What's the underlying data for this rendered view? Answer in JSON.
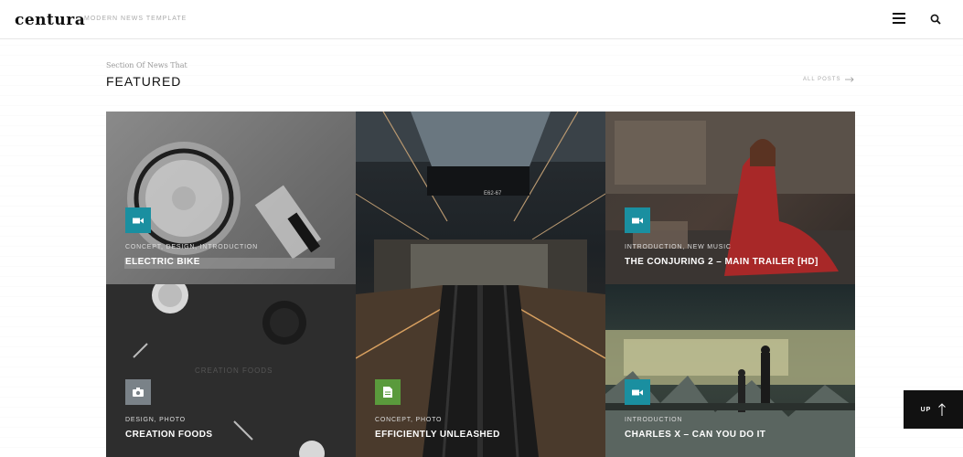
{
  "header": {
    "logo": "centura",
    "tagline": "MODERN NEWS TEMPLATE"
  },
  "section": {
    "subtitle": "Section Of News That",
    "title": "FEATURED",
    "all_posts": "ALL POSTS"
  },
  "cards": [
    {
      "categories": "CONCEPT, DESIGN, INTRODUCTION",
      "title": "ELECTRIC BIKE",
      "badge_icon": "video-icon",
      "badge_color": "#1a8fa0"
    },
    {
      "categories": "CONCEPT, PHOTO",
      "title": "EFFICIENTLY UNLEASHED",
      "badge_icon": "document-icon",
      "badge_color": "#5a9a3c",
      "sign_text": "E62-67"
    },
    {
      "categories": "INTRODUCTION, NEW MUSIC",
      "title": "THE CONJURING 2 – MAIN TRAILER [HD]",
      "badge_icon": "video-icon",
      "badge_color": "#1a8fa0"
    },
    {
      "categories": "DESIGN, PHOTO",
      "title": "CREATION FOODS",
      "badge_icon": "camera-icon",
      "badge_color": "#7a8288",
      "image_text": "CREATION FOODS"
    },
    {
      "categories": "INTRODUCTION",
      "title": "CHARLES X – CAN YOU DO IT",
      "badge_icon": "video-icon",
      "badge_color": "#1a8fa0"
    }
  ],
  "up_button": "UP"
}
